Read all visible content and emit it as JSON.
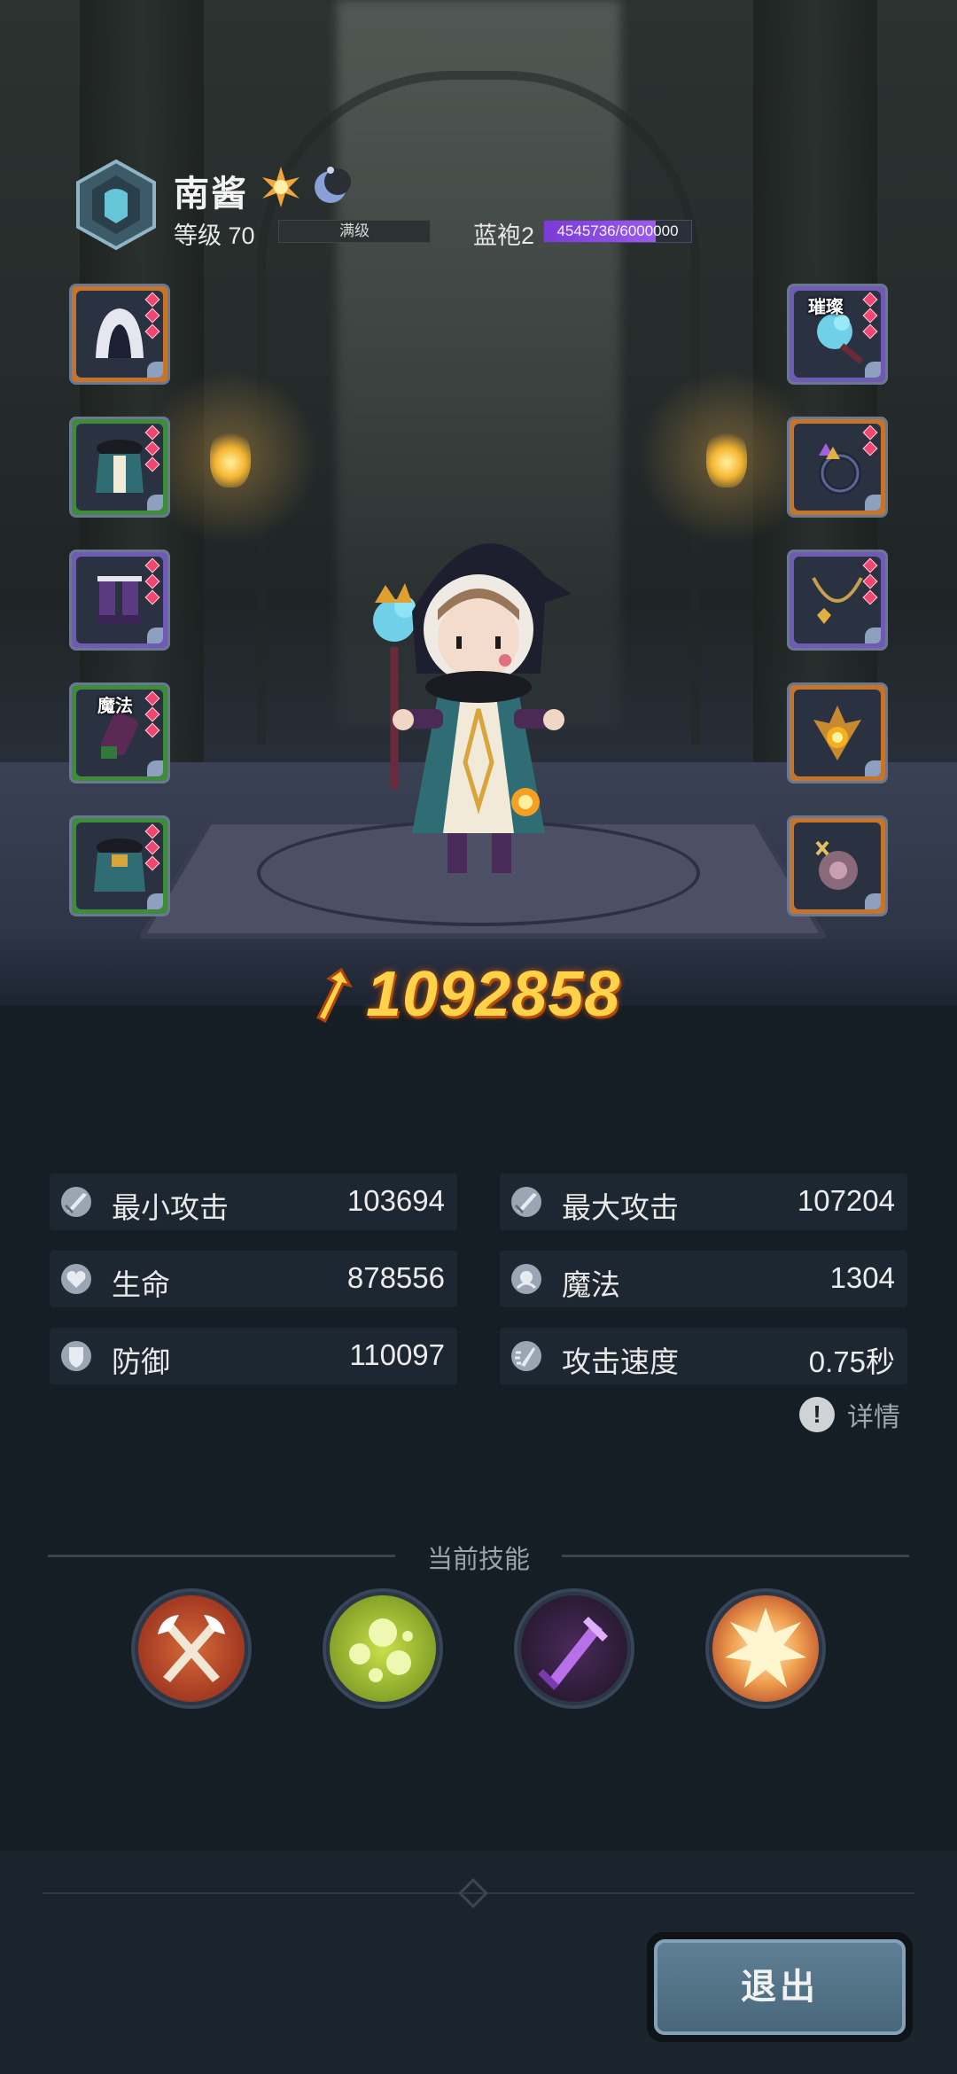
{
  "header": {
    "name": "南酱",
    "level_label": "等级 70",
    "level_status": "满级",
    "robe_label": "蓝袍2",
    "robe_xp": "4545736/6000000",
    "robe_xp_progress": 0.758
  },
  "equipment": {
    "left": [
      {
        "name": "hood",
        "frame": "orange",
        "gems": 3,
        "tag": ""
      },
      {
        "name": "robe-armor",
        "frame": "green",
        "gems": 3,
        "tag": ""
      },
      {
        "name": "boots",
        "frame": "purple",
        "gems": 3,
        "tag": ""
      },
      {
        "name": "gloves",
        "frame": "green",
        "gems": 3,
        "tag": "魔法"
      },
      {
        "name": "cloak",
        "frame": "green",
        "gems": 3,
        "tag": ""
      }
    ],
    "right": [
      {
        "name": "staff",
        "frame": "orange",
        "gems": 3,
        "tag": "璀璨"
      },
      {
        "name": "ring",
        "frame": "orange",
        "gems": 2,
        "tag": ""
      },
      {
        "name": "necklace",
        "frame": "purple",
        "gems": 3,
        "tag": ""
      },
      {
        "name": "fire-orb",
        "frame": "orange",
        "gems": 0,
        "tag": ""
      },
      {
        "name": "trinket",
        "frame": "orange",
        "gems": 0,
        "tag": ""
      }
    ]
  },
  "power": {
    "value": "1092858"
  },
  "stats": {
    "min_attack": {
      "label": "最小攻击",
      "value": "103694"
    },
    "max_attack": {
      "label": "最大攻击",
      "value": "107204"
    },
    "life": {
      "label": "生命",
      "value": "878556"
    },
    "magic": {
      "label": "魔法",
      "value": "1304"
    },
    "defense": {
      "label": "防御",
      "value": "110097"
    },
    "attack_speed": {
      "label": "攻击速度",
      "value": "0.75秒"
    }
  },
  "detail": {
    "icon": "!",
    "label": "详情"
  },
  "skills": {
    "title": "当前技能",
    "items": [
      "crossed-axes-skill",
      "poison-bubbles-skill",
      "shadow-sword-skill",
      "explosion-skill"
    ]
  },
  "footer": {
    "exit_label": "退出"
  }
}
